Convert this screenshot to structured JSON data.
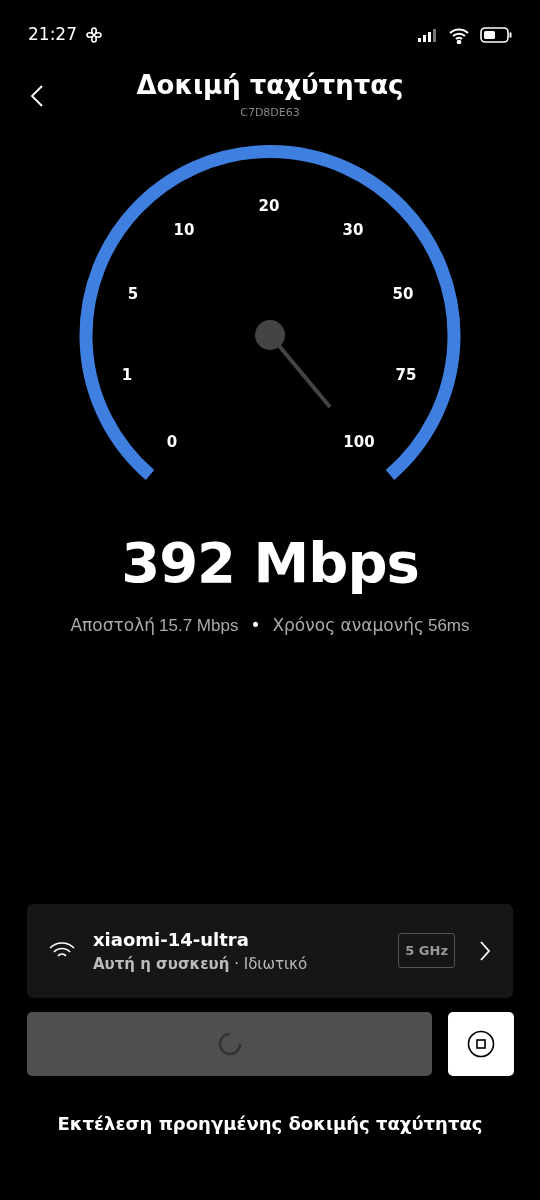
{
  "status_bar": {
    "time": "21:27"
  },
  "header": {
    "title": "Δοκιμή ταχύτητας",
    "subtitle": "C7D8DE63"
  },
  "gauge": {
    "labels": [
      "0",
      "1",
      "5",
      "10",
      "20",
      "30",
      "50",
      "75",
      "100"
    ]
  },
  "result": {
    "speed": "392 Mbps",
    "upload_label": "Αποστολή",
    "upload_value": "15.7 Mbps",
    "separator": "•",
    "latency_label": "Χρόνος αναμονής",
    "latency_value": "56ms"
  },
  "network": {
    "name": "xiaomi-14-ultra",
    "detail": "**Αυτή η συσκευή** · Ιδιωτικό",
    "band": "5 GHz"
  },
  "progress": {
    "loading": true
  },
  "advanced_link": "Εκτέλεση προηγμένης δοκιμής ταχύτητας"
}
